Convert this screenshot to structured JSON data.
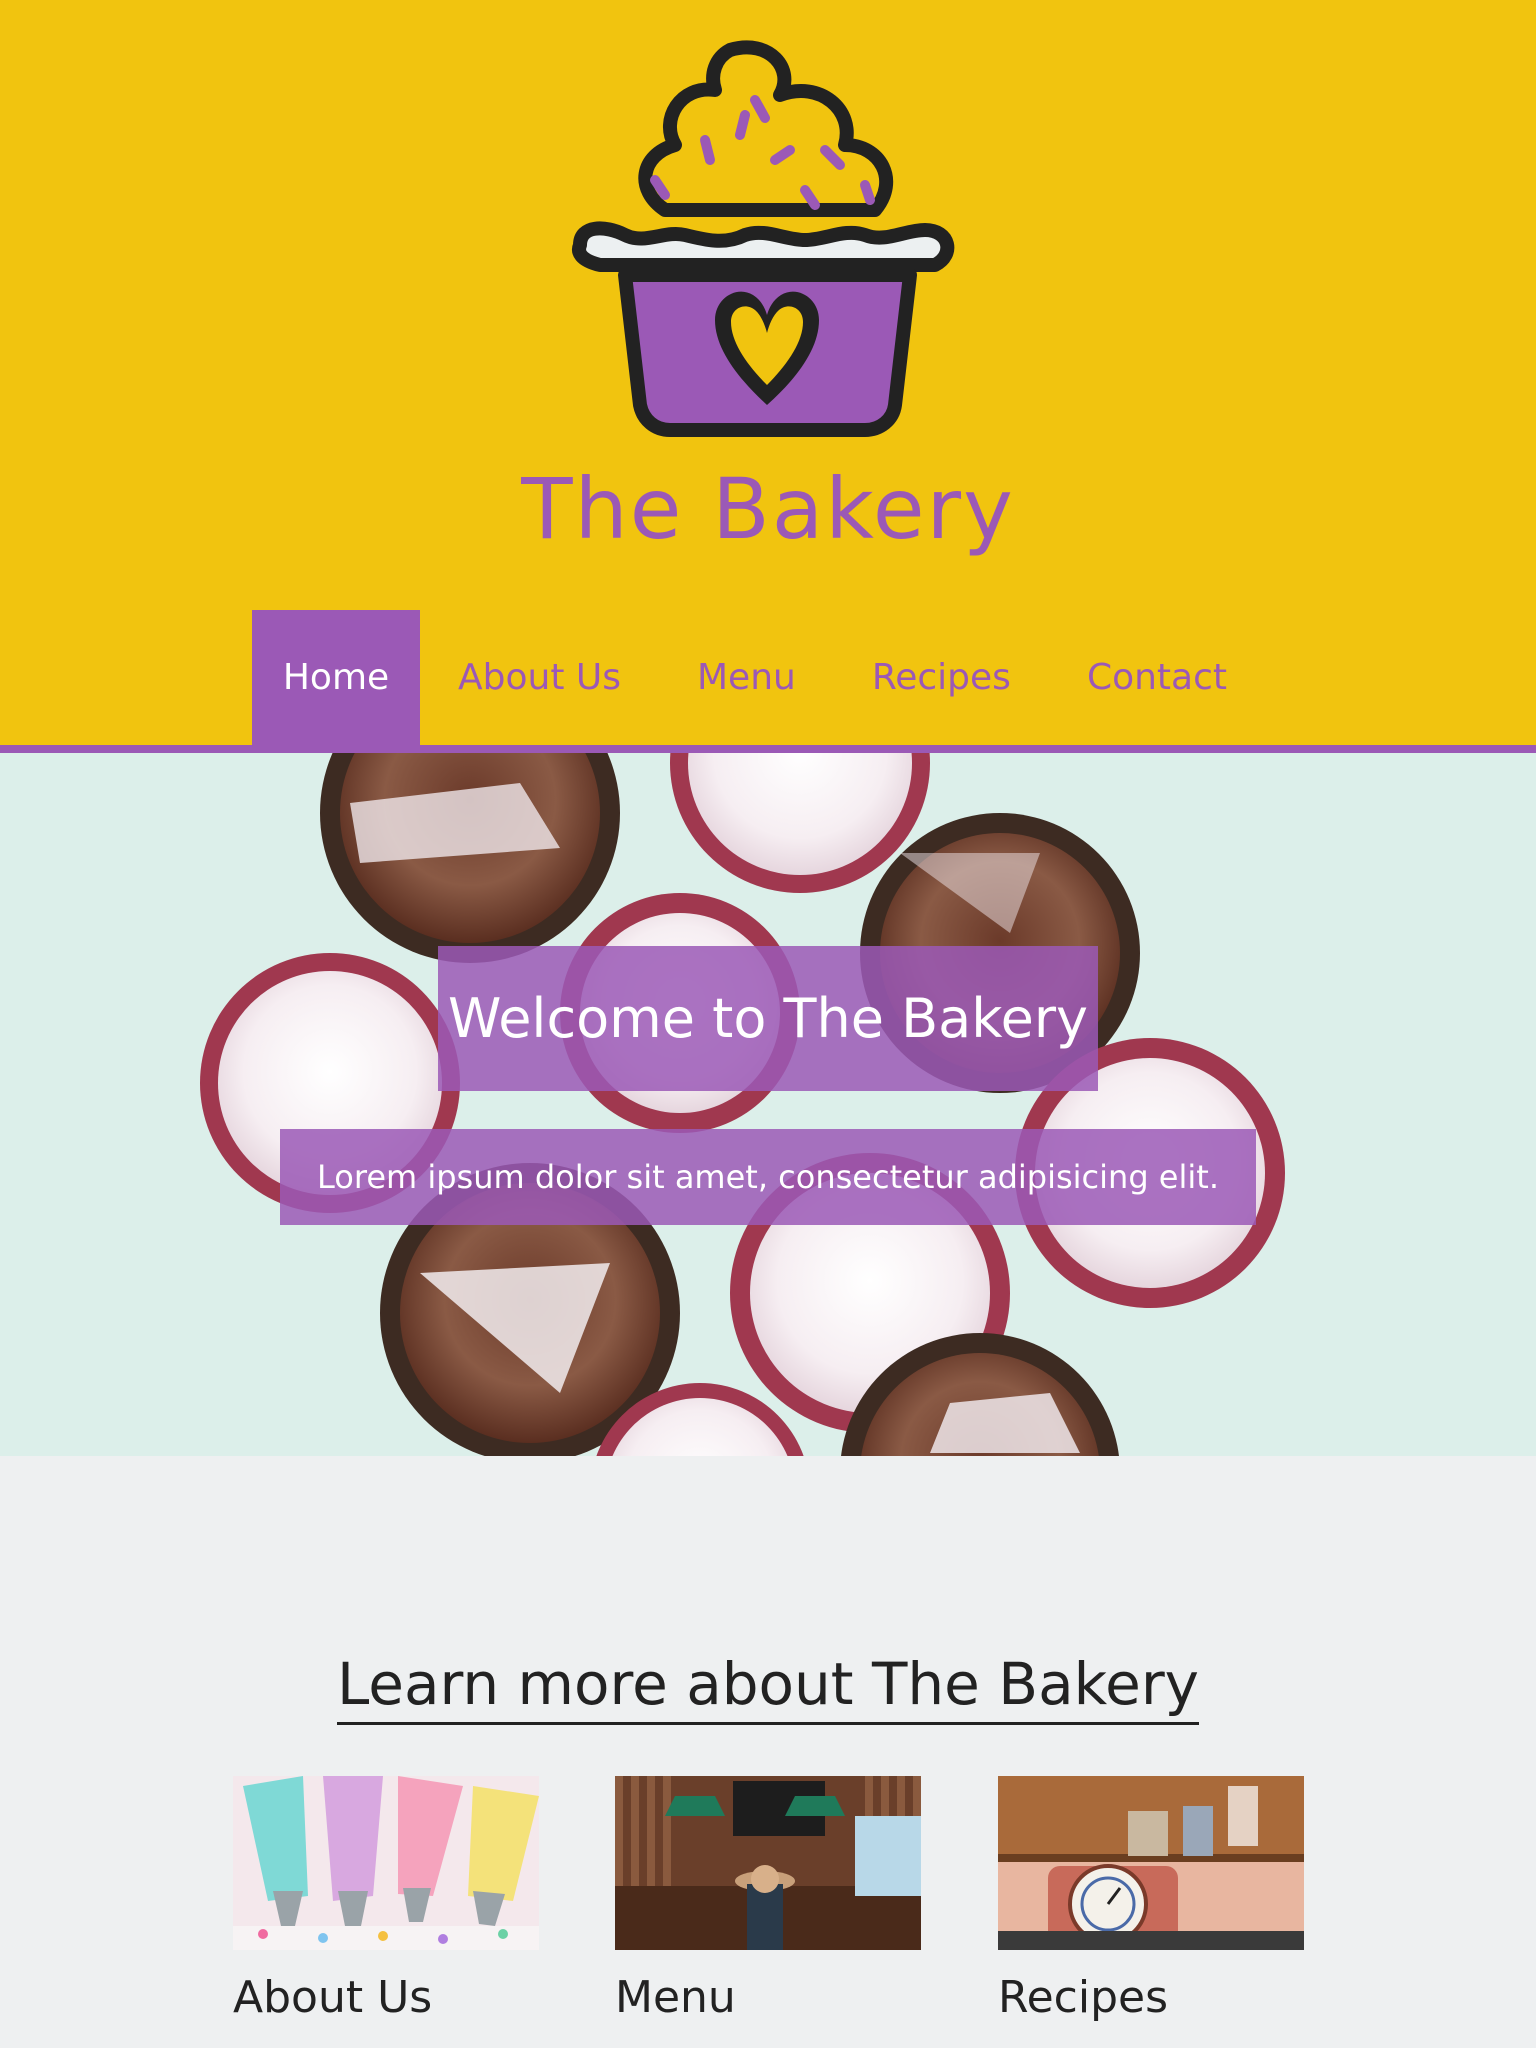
{
  "brand": {
    "title": "The Bakery",
    "primary": "#9b59b6",
    "accent": "#f1c40f"
  },
  "nav": {
    "items": [
      {
        "label": "Home",
        "active": true
      },
      {
        "label": "About Us",
        "active": false
      },
      {
        "label": "Menu",
        "active": false
      },
      {
        "label": "Recipes",
        "active": false
      },
      {
        "label": "Contact",
        "active": false
      }
    ]
  },
  "hero": {
    "title": "Welcome to The Bakery",
    "subtitle": "Lorem ipsum dolor sit amet, consectetur adipisicing elit."
  },
  "learn": {
    "title": "Learn more about The Bakery",
    "cards": [
      {
        "label": "About Us"
      },
      {
        "label": "Menu"
      },
      {
        "label": "Recipes"
      }
    ]
  }
}
